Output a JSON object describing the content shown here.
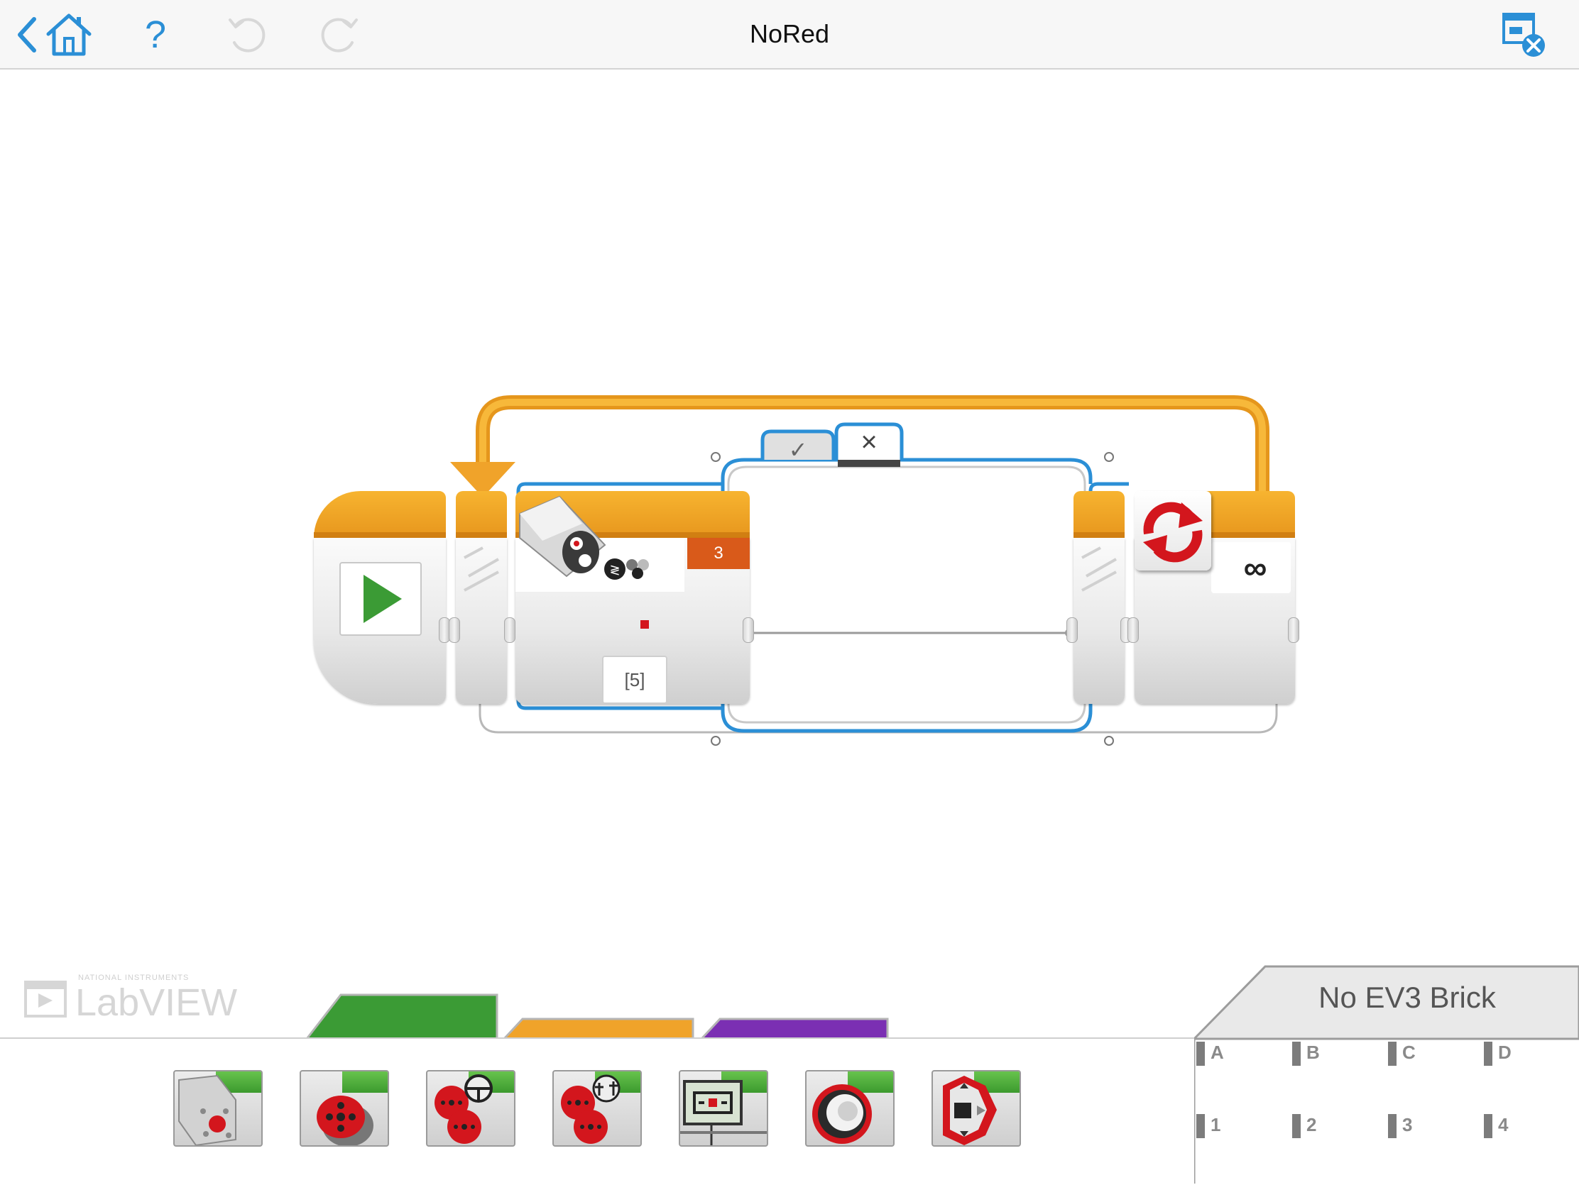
{
  "app": {
    "title": "NoRed"
  },
  "toolbar": {
    "back_icon": "chevron-left-icon",
    "home_icon": "home-icon",
    "help_label": "?",
    "undo_icon": "undo-icon",
    "redo_icon": "redo-icon",
    "close_project_icon": "close-project-icon"
  },
  "program": {
    "loop_count_label": "∞",
    "switch_tab_true": "✓",
    "switch_tab_false": "×",
    "sensor_port": "3",
    "sensor_value": "[5]"
  },
  "watermark": {
    "vendor": "NATIONAL INSTRUMENTS",
    "product": "LabVIEW"
  },
  "palette": {
    "tabs": [
      {
        "name": "action",
        "color": "#3b9b35"
      },
      {
        "name": "flow-control",
        "color": "#f5a623"
      },
      {
        "name": "sensor",
        "color": "#7b2fb3"
      }
    ],
    "blocks": [
      "medium-motor-icon",
      "large-motor-icon",
      "move-steering-icon",
      "move-tank-icon",
      "display-icon",
      "sound-icon",
      "brick-status-light-icon"
    ]
  },
  "brick": {
    "status": "No EV3 Brick",
    "motor_ports": [
      "A",
      "B",
      "C",
      "D"
    ],
    "sensor_ports": [
      "1",
      "2",
      "3",
      "4"
    ]
  },
  "colors": {
    "accent_blue": "#2b8fd6",
    "flow_orange": "#f0a32a",
    "action_green": "#3b9b35",
    "sensor_purple": "#7b2fb3",
    "loop_red": "#d3161d"
  }
}
